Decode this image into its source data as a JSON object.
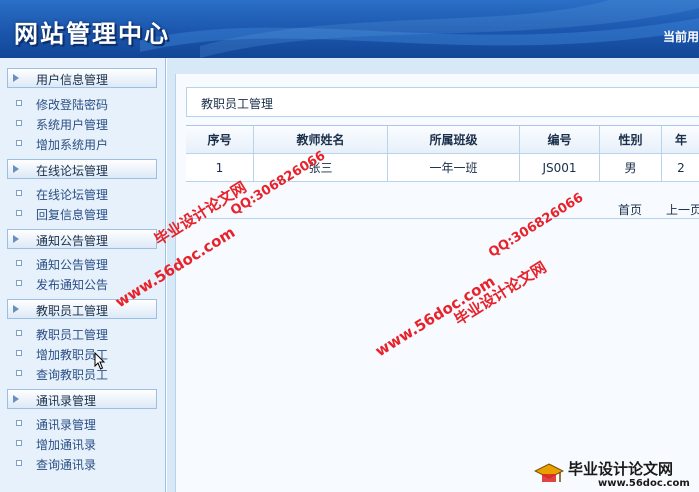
{
  "header": {
    "title": "网站管理中心",
    "user_label": "当前用"
  },
  "sidebar": {
    "groups": [
      {
        "label": "用户信息管理",
        "items": [
          "修改登陆密码",
          "系统用户管理",
          "增加系统用户"
        ]
      },
      {
        "label": "在线论坛管理",
        "items": [
          "在线论坛管理",
          "回复信息管理"
        ]
      },
      {
        "label": "通知公告管理",
        "items": [
          "通知公告管理",
          "发布通知公告"
        ]
      },
      {
        "label": "教职员工管理",
        "items": [
          "教职员工管理",
          "增加教职员工",
          "查询教职员工"
        ]
      },
      {
        "label": "通讯录管理",
        "items": [
          "通讯录管理",
          "增加通讯录",
          "查询通讯录"
        ]
      }
    ]
  },
  "main": {
    "breadcrumb": "教职员工管理",
    "table": {
      "columns": [
        "序号",
        "教师姓名",
        "所属班级",
        "编号",
        "性别",
        "年"
      ],
      "rows": [
        [
          "1",
          "张三",
          "一年一班",
          "JS001",
          "男",
          "2"
        ]
      ]
    },
    "pager": {
      "first": "首页",
      "prev": "上一页"
    }
  },
  "watermarks": {
    "site_name": "毕业设计论文网",
    "url": "www.56doc.com",
    "qq": "QQ:306826066"
  },
  "corner_logo": {
    "title": "毕业设计论文网",
    "url": "www.56doc.com"
  },
  "colors": {
    "header_blue": "#1b56ad",
    "sidebar_bg": "#e7f1fb",
    "watermark_red": "#e8222a"
  }
}
